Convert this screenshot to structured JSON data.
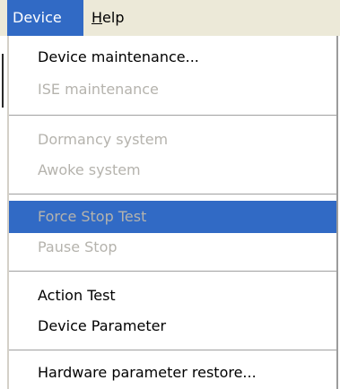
{
  "menubar": {
    "items": [
      {
        "label": "Device",
        "active": true
      },
      {
        "label": "Help",
        "active": false
      }
    ]
  },
  "dropdown": {
    "items": [
      {
        "label": "Device maintenance...",
        "enabled": true
      },
      {
        "label": "ISE maintenance",
        "enabled": false
      },
      {
        "label": "Dormancy system",
        "enabled": false
      },
      {
        "label": "Awoke system",
        "enabled": false
      },
      {
        "label": "Force Stop Test",
        "enabled": false,
        "highlighted": true
      },
      {
        "label": "Pause Stop",
        "enabled": false
      },
      {
        "label": "Action Test",
        "enabled": true
      },
      {
        "label": "Device Parameter",
        "enabled": true
      },
      {
        "label": "Hardware parameter restore...",
        "enabled": true
      }
    ]
  },
  "colors": {
    "selection": "#316ac5",
    "disabled_text": "#b5b3ad",
    "menubar_bg": "#ece9d8",
    "separator": "#a0a0a0"
  }
}
